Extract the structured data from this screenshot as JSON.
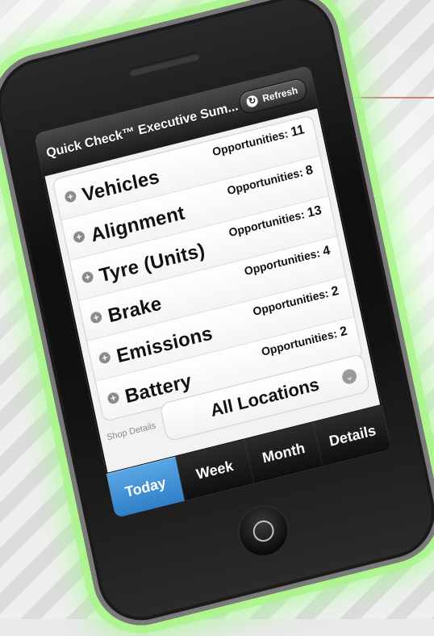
{
  "app": {
    "title": "Quick Check™ Executive Sum...",
    "refresh_label": "Refresh"
  },
  "summary": {
    "rows": [
      {
        "label": "Vehicles",
        "opportunities_label": "Opportunities:",
        "opportunities_value": "11"
      },
      {
        "label": "Alignment",
        "opportunities_label": "Opportunities:",
        "opportunities_value": "8"
      },
      {
        "label": "Tyre (Units)",
        "opportunities_label": "Opportunities:",
        "opportunities_value": "13"
      },
      {
        "label": "Brake",
        "opportunities_label": "Opportunities:",
        "opportunities_value": "4"
      },
      {
        "label": "Emissions",
        "opportunities_label": "Opportunities:",
        "opportunities_value": "2"
      },
      {
        "label": "Battery",
        "opportunities_label": "Opportunities:",
        "opportunities_value": "2"
      }
    ]
  },
  "shop": {
    "details_label": "Shop Details",
    "selected_location": "All Locations"
  },
  "tabs": [
    {
      "label": "Today",
      "active": true
    },
    {
      "label": "Week",
      "active": false
    },
    {
      "label": "Month",
      "active": false
    },
    {
      "label": "Details",
      "active": false
    }
  ],
  "icons": {
    "refresh": "refresh-icon",
    "expand": "plus-circle-icon",
    "dropdown": "chevron-down-icon"
  },
  "colors": {
    "active_tab": "#2f7fc7",
    "glow": "#8cff6e"
  }
}
